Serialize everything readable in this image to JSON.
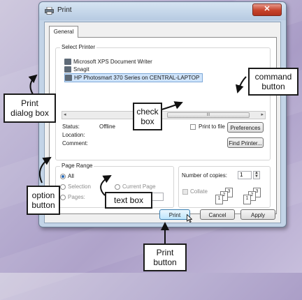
{
  "window": {
    "title": "Print",
    "close_glyph": "✕",
    "tab_label": "General"
  },
  "select_printer": {
    "legend": "Select Printer",
    "printers": [
      {
        "name": "Microsoft XPS Document Writer",
        "icon": "printer-icon"
      },
      {
        "name": "Snagit",
        "icon": "printer-icon"
      },
      {
        "name": "HP Photosmart 370 Series on CENTRAL-LAPTOP",
        "icon": "printer-icon",
        "selected": true
      }
    ],
    "scroll_left": "◂",
    "scroll_right": "▸",
    "scroll_grip": "III",
    "status_label": "Status:",
    "status_value": "Offline",
    "location_label": "Location:",
    "comment_label": "Comment:",
    "print_to_file_label": "Print to file",
    "preferences_button": "Preferences",
    "find_printer_button": "Find Printer..."
  },
  "page_range": {
    "legend": "Page Range",
    "all": "All",
    "selection": "Selection",
    "current_page": "Current Page",
    "pages": "Pages:",
    "pages_value": ""
  },
  "copies": {
    "label": "Number of copies:",
    "value": "1",
    "spin_up": "▲",
    "spin_down": "▼",
    "collate_label": "Collate",
    "page_numbers": [
      "1",
      "2",
      "3"
    ]
  },
  "buttons": {
    "print": "Print",
    "cancel": "Cancel",
    "apply": "Apply"
  },
  "callouts": {
    "print_dialog_box": "Print dialog box",
    "check_box": "check box",
    "command_button": "command button",
    "option_button": "option button",
    "text_box": "text box",
    "print_button": "Print button"
  }
}
